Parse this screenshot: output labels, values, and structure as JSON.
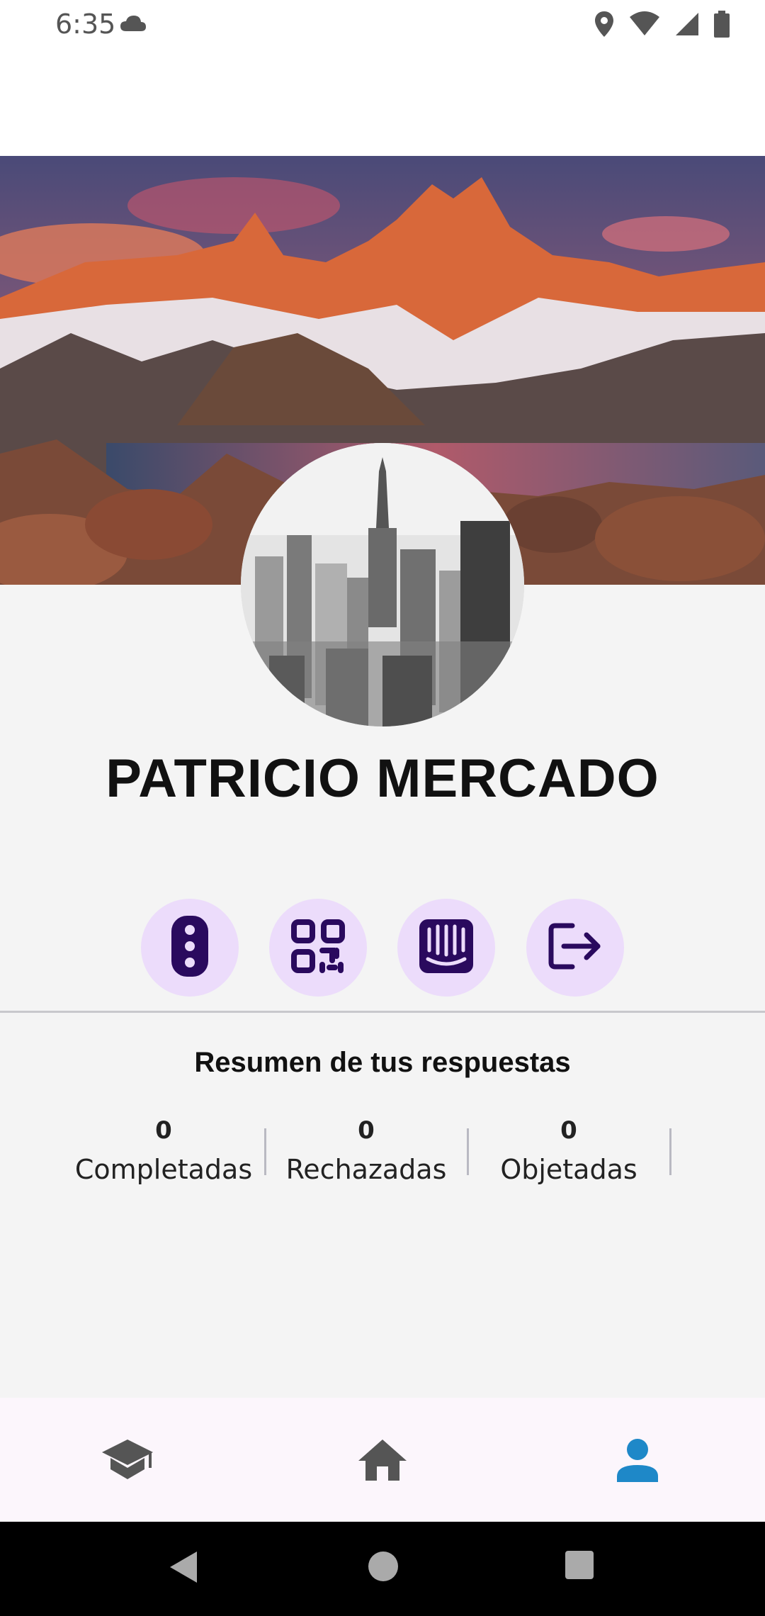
{
  "status_bar": {
    "time": "6:35",
    "left_icons": [
      "cloud-icon"
    ],
    "right_icons": [
      "location-icon",
      "wifi-icon",
      "signal-icon",
      "battery-icon"
    ]
  },
  "profile": {
    "cover_image": "mountain-lake-landscape",
    "avatar_image": "city-skyline-grayscale",
    "name": "PATRICIO MERCADO"
  },
  "actions": [
    {
      "icon": "traffic-light-icon"
    },
    {
      "icon": "qr-code-icon"
    },
    {
      "icon": "intercom-icon"
    },
    {
      "icon": "logout-icon"
    }
  ],
  "summary": {
    "title": "Resumen de tus respuestas",
    "stats": [
      {
        "value": "0",
        "label": "Completadas"
      },
      {
        "value": "0",
        "label": "Rechazadas"
      },
      {
        "value": "0",
        "label": "Objetadas"
      }
    ]
  },
  "bottom_nav": {
    "items": [
      {
        "icon": "school-icon",
        "active": false
      },
      {
        "icon": "home-icon",
        "active": false
      },
      {
        "icon": "person-icon",
        "active": true
      }
    ],
    "active_color": "#1e88c8",
    "inactive_color": "#555555"
  },
  "system_nav": [
    "back-icon",
    "home-circle-icon",
    "recents-icon"
  ],
  "colors": {
    "accent_bg": "#ecdcfb",
    "accent_icon": "#2a0a5e"
  }
}
